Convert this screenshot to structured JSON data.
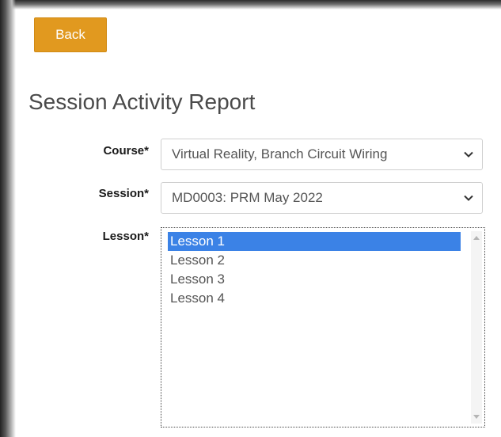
{
  "back_button": {
    "label": "Back"
  },
  "page": {
    "title": "Session Activity Report"
  },
  "form": {
    "course": {
      "label": "Course*",
      "selected": "Virtual Reality, Branch Circuit Wiring"
    },
    "session": {
      "label": "Session*",
      "selected": "MD0003: PRM May 2022"
    },
    "lesson": {
      "label": "Lesson*",
      "options": [
        "Lesson 1",
        "Lesson 2",
        "Lesson 3",
        "Lesson 4"
      ],
      "selected_index": 0
    }
  },
  "icons": {
    "select_chevron": "chevron-down-icon",
    "scroll_up": "scroll-up-arrow-icon",
    "scroll_down": "scroll-down-arrow-icon"
  },
  "colors": {
    "accent": "#e1991f",
    "selection": "#3b82e6",
    "title_text": "#4a4a4a"
  }
}
